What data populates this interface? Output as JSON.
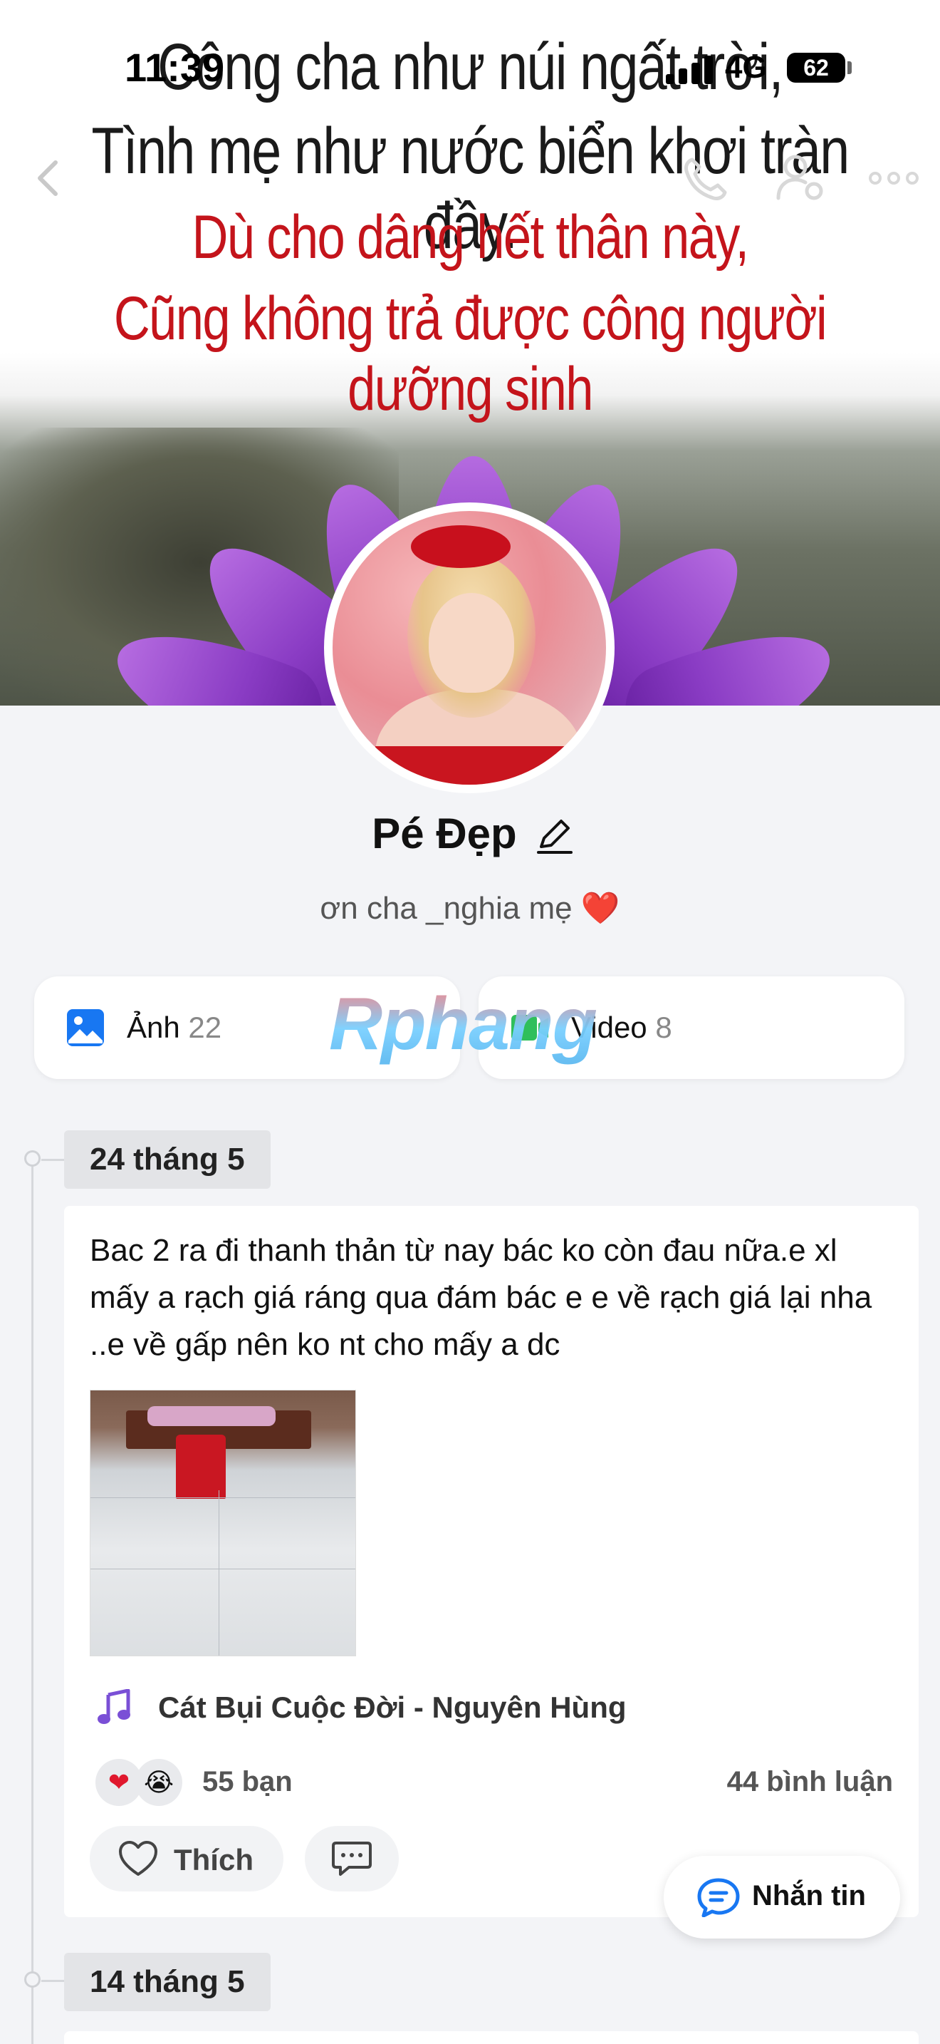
{
  "status_bar": {
    "time": "11:39",
    "network": "4G",
    "battery": "62"
  },
  "cover": {
    "lines": [
      "Công cha như núi ngất trời,",
      "Tình mẹ như nước biển khơi tràn đầy.",
      "Dù cho dâng hết thân này,",
      "Cũng không trả được công người dưỡng sinh"
    ],
    "text_dark_color": "#1a1a1a",
    "text_red_color": "#c4141b"
  },
  "profile": {
    "name": "Pé Đẹp",
    "bio": "ơn cha _nghia mẹ ❤️"
  },
  "media": {
    "photos_label": "Ảnh",
    "photos_count": "22",
    "videos_label": "Video",
    "videos_count": "8",
    "photo_icon_color": "#1877f2",
    "video_icon_color": "#2fbf5b"
  },
  "watermark": "Rphang",
  "timeline": [
    {
      "date": "24 tháng 5",
      "post": {
        "text": "Bac 2 ra đi thanh thản từ nay bác ko còn đau nữa.e xl mấy a rạch giá ráng qua đám bác e e về rạch giá lại nha ..e về gấp nên ko nt cho mấy a dc",
        "music": "Cát Bụi Cuộc Đời - Nguyên Hùng",
        "reaction_heart": "❤",
        "reaction_sad": "😭",
        "reaction_count": "55 bạn",
        "comment_count": "44 bình luận",
        "like_label": "Thích"
      }
    },
    {
      "date": "14 tháng 5"
    }
  ],
  "message_button": {
    "label": "Nhắn tin"
  },
  "icons": {
    "back": "chevron-left-icon",
    "call": "phone-icon",
    "settings": "user-settings-icon",
    "more": "more-dots-icon",
    "edit": "pencil-icon",
    "music": "music-note-icon",
    "like": "heart-outline-icon",
    "comment": "comment-icon",
    "message": "chat-bubble-icon"
  }
}
